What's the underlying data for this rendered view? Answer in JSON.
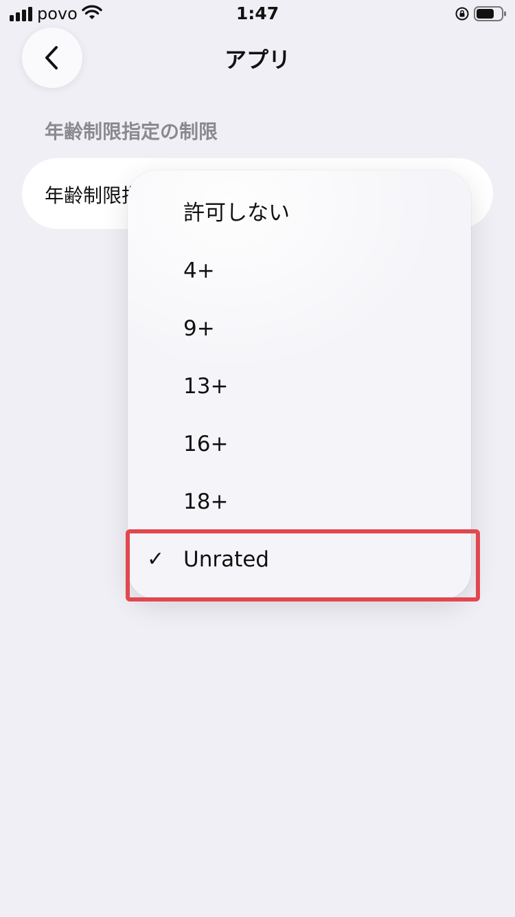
{
  "status_bar": {
    "carrier": "povo",
    "time": "1:47",
    "icons": [
      "signal-icon",
      "wifi-icon",
      "orientation-lock-icon",
      "battery-icon"
    ]
  },
  "header": {
    "back_icon": "chevron-left-icon",
    "title": "アプリ"
  },
  "section": {
    "title": "年齢制限指定の制限"
  },
  "setting": {
    "label": "年齢制限指"
  },
  "menu": {
    "items": [
      {
        "label": "許可しない",
        "checked": false
      },
      {
        "label": "4+",
        "checked": false
      },
      {
        "label": "9+",
        "checked": false
      },
      {
        "label": "13+",
        "checked": false
      },
      {
        "label": "16+",
        "checked": false
      },
      {
        "label": "18+",
        "checked": false
      },
      {
        "label": "Unrated",
        "checked": true,
        "check_mark": "✓"
      }
    ]
  },
  "colors": {
    "background": "#f0eff5",
    "highlight": "#e2474f",
    "section_title": "#8a8a8e"
  }
}
